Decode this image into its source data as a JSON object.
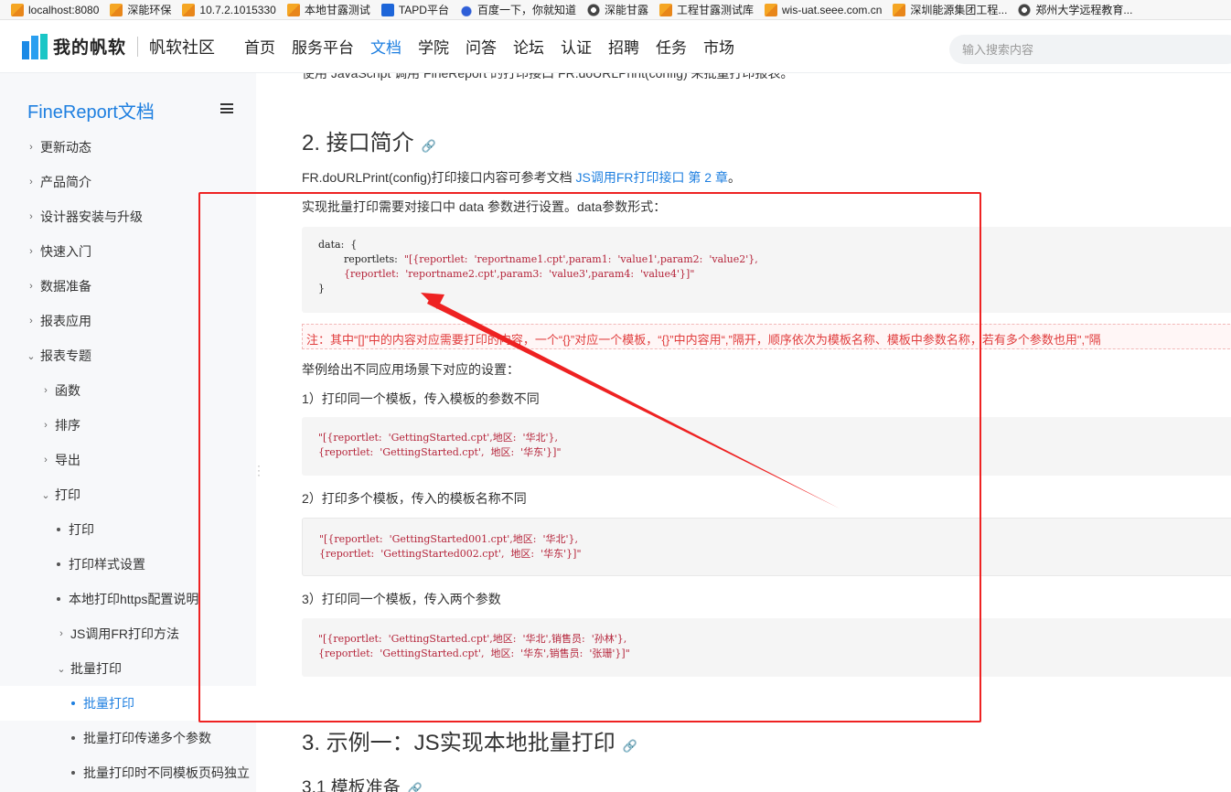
{
  "bookmarks": [
    {
      "label": "localhost:8080",
      "icon": "fr-icon"
    },
    {
      "label": "深能环保",
      "icon": "fr-icon"
    },
    {
      "label": "10.7.2.1015330",
      "icon": "fr-icon"
    },
    {
      "label": "本地甘露测试",
      "icon": "fr-icon"
    },
    {
      "label": "TAPD平台",
      "icon": "tapd-icon"
    },
    {
      "label": "百度一下，你就知道",
      "icon": "baidu-icon"
    },
    {
      "label": "深能甘露",
      "icon": "globe-icon"
    },
    {
      "label": "工程甘露测试库",
      "icon": "fr-icon"
    },
    {
      "label": "wis-uat.seee.com.cn",
      "icon": "fr-icon"
    },
    {
      "label": "深圳能源集团工程...",
      "icon": "fr-icon"
    },
    {
      "label": "郑州大学远程教育...",
      "icon": "globe-icon"
    }
  ],
  "header": {
    "logo_text": "我的帆软",
    "logo_sub": "帆软社区",
    "nav": [
      "首页",
      "服务平台",
      "文档",
      "学院",
      "问答",
      "论坛",
      "认证",
      "招聘",
      "任务",
      "市场"
    ],
    "active_nav": "文档",
    "search_placeholder": "输入搜索内容"
  },
  "sidebar": {
    "title": "FineReport文档",
    "items": [
      {
        "label": "更新动态",
        "level": 0,
        "marker": "›"
      },
      {
        "label": "产品简介",
        "level": 0,
        "marker": "›"
      },
      {
        "label": "设计器安装与升级",
        "level": 0,
        "marker": "›"
      },
      {
        "label": "快速入门",
        "level": 0,
        "marker": "›"
      },
      {
        "label": "数据准备",
        "level": 0,
        "marker": "›"
      },
      {
        "label": "报表应用",
        "level": 0,
        "marker": "›"
      },
      {
        "label": "报表专题",
        "level": 0,
        "marker": "⌄"
      },
      {
        "label": "函数",
        "level": 1,
        "marker": "›"
      },
      {
        "label": "排序",
        "level": 1,
        "marker": "›"
      },
      {
        "label": "导出",
        "level": 1,
        "marker": "›"
      },
      {
        "label": "打印",
        "level": 1,
        "marker": "⌄"
      },
      {
        "label": "打印",
        "level": 2,
        "marker": "dot"
      },
      {
        "label": "打印样式设置",
        "level": 2,
        "marker": "dot"
      },
      {
        "label": "本地打印https配置说明",
        "level": 2,
        "marker": "dot"
      },
      {
        "label": "JS调用FR打印方法",
        "level": 2,
        "marker": "›"
      },
      {
        "label": "批量打印",
        "level": 2,
        "marker": "⌄"
      },
      {
        "label": "批量打印",
        "level": 3,
        "marker": "dot",
        "active": true
      },
      {
        "label": "批量打印传递多个参数",
        "level": 3,
        "marker": "dot"
      },
      {
        "label": "批量打印时不同模板页码独立",
        "level": 3,
        "marker": "dot"
      }
    ]
  },
  "content": {
    "cut_line": "使用 JavaScript 调用 FineReport 的打印接口 FR.doURLPrint(config) 来批量打印报表。",
    "section2_title": "2. 接口简介",
    "intro_prefix": "FR.doURLPrint(config)打印接口内容可参考文档 ",
    "intro_link": "JS调用FR打印接口 第 2 章",
    "intro_suffix": "。",
    "data_intro": "实现批量打印需要对接口中 data 参数进行设置。data参数形式：",
    "code_main": {
      "l1": "data:  {",
      "l2a": "        reportlets:  ",
      "l2b": "\"[{reportlet:  'reportname1.cpt',param1:  'value1',param2:  'value2'},",
      "l3": "        {reportlet:  'reportname2.cpt',param3:  'value3',param4:  'value4'}]\"",
      "l4": "}"
    },
    "note": "注：其中“[]”中的内容对应需要打印的内容，一个“{}”对应一个模板，“{}”中内容用“,”隔开，顺序依次为模板名称、模板中参数名称，若有多个参数也用\",\"隔",
    "examples_intro": "举例给出不同应用场景下对应的设置：",
    "ex1_title": "1）打印同一个模板，传入模板的参数不同",
    "ex1_code_l1": "\"[{reportlet:  'GettingStarted.cpt',地区:  '华北'},",
    "ex1_code_l2": "{reportlet:  'GettingStarted.cpt',  地区:  '华东'}]\"",
    "ex2_title": "2）打印多个模板，传入的模板名称不同",
    "ex2_code_l1": "\"[{reportlet:  'GettingStarted001.cpt',地区:  '华北'},",
    "ex2_code_l2": "{reportlet:  'GettingStarted002.cpt',  地区:  '华东'}]\"",
    "ex3_title": "3）打印同一个模板，传入两个参数",
    "ex3_code_l1": "\"[{reportlet:  'GettingStarted.cpt',地区:  '华北',销售员:  '孙林'},",
    "ex3_code_l2": "{reportlet:  'GettingStarted.cpt',  地区:  '华东',销售员:  '张珊'}]\"",
    "section3_title": "3. 示例一：JS实现本地批量打印",
    "section31_title": "3.1 模板准备",
    "anchor_glyph": "🔗"
  },
  "colors": {
    "accent": "#1e7fe0",
    "annotation": "#ee2222",
    "code_text": "#b5243a",
    "note_text": "#e03c3c"
  }
}
